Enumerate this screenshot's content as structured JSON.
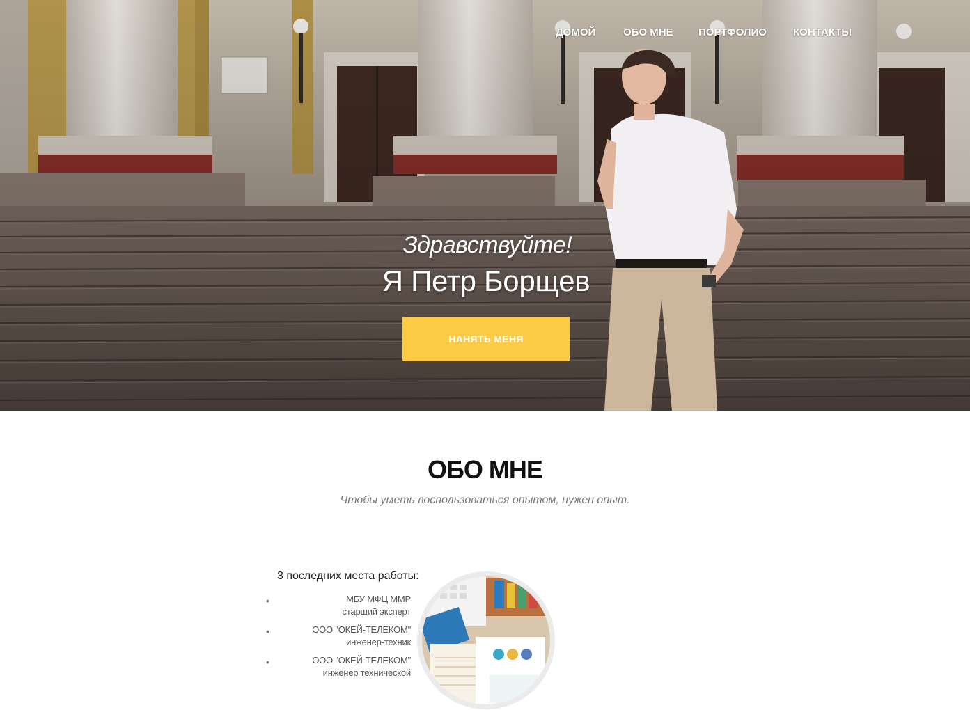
{
  "nav": {
    "items": [
      {
        "label": "ДОМОЙ"
      },
      {
        "label": "ОБО МНЕ"
      },
      {
        "label": "ПОРТФОЛИО"
      },
      {
        "label": "КОНТАКТЫ"
      }
    ]
  },
  "hero": {
    "greeting": "Здравствуйте!",
    "name": "Я Петр Борщев",
    "hire_button": "НАНЯТЬ МЕНЯ"
  },
  "about": {
    "title": "ОБО МНЕ",
    "subtitle": "Чтобы уметь воспользоваться опытом, нужен опыт.",
    "jobs_heading": "3 последних места работы:",
    "jobs": [
      {
        "company": "МБУ МФЦ ММР",
        "position": "старший эксперт"
      },
      {
        "company": "ООО \"ОКЕЙ-ТЕЛЕКОМ\"",
        "position": "инженер-техник"
      },
      {
        "company": "ООО \"ОКЕЙ-ТЕЛЕКОМ\"",
        "position": "инженер технической"
      }
    ]
  },
  "colors": {
    "accent": "#fccb44",
    "heading": "#111111",
    "muted": "#7a7a7a"
  },
  "icons": {
    "job_bullet": "bullet-icon"
  }
}
